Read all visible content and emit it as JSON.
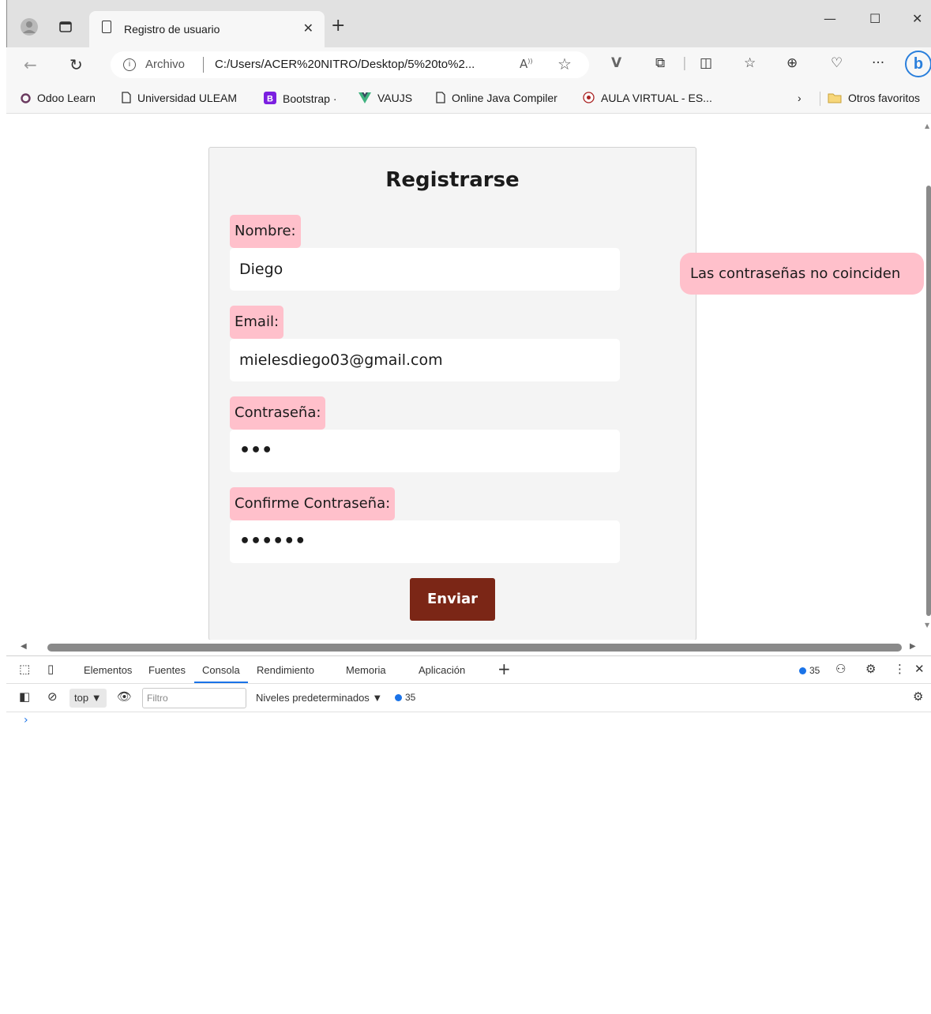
{
  "tab": {
    "title": "Registro de usuario"
  },
  "address": {
    "scheme": "Archivo",
    "url": "C:/Users/ACER%20NITRO/Desktop/5%20to%2..."
  },
  "bookmarks": [
    {
      "label": "Odoo Learn",
      "icon": "odoo-icon"
    },
    {
      "label": "Universidad ULEAM",
      "icon": "page-icon"
    },
    {
      "label": "Bootstrap ·",
      "icon": "bootstrap-icon"
    },
    {
      "label": "VAUJS",
      "icon": "vue-icon"
    },
    {
      "label": "Online Java Compiler",
      "icon": "page-icon"
    },
    {
      "label": "AULA VIRTUAL - ES...",
      "icon": "aula-icon"
    }
  ],
  "other_favorites": "Otros favoritos",
  "form": {
    "heading": "Registrarse",
    "fields": [
      {
        "label": "Nombre:",
        "value": "Diego"
      },
      {
        "label": "Email:",
        "value": "mielesdiego03@gmail.com"
      },
      {
        "label": "Contraseña:",
        "value": "•••"
      },
      {
        "label": "Confirme Contraseña:",
        "value": "••••••"
      }
    ],
    "submit": "Enviar"
  },
  "alert": {
    "message": "Las contraseñas no coinciden"
  },
  "devtools": {
    "tabs": [
      "Elementos",
      "Fuentes",
      "Consola",
      "Rendimiento",
      "Memoria",
      "Aplicación"
    ],
    "active_tab": "Consola",
    "issues_count": "35",
    "context": "top",
    "filter_placeholder": "Filtro",
    "levels": "Niveles predeterminados",
    "messages_count": "35",
    "prompt": "›"
  },
  "colors": {
    "label_bg": "#ffc0cb",
    "submit_bg": "#7b2616",
    "card_bg": "#f4f4f4",
    "accent": "#1a73e8"
  }
}
